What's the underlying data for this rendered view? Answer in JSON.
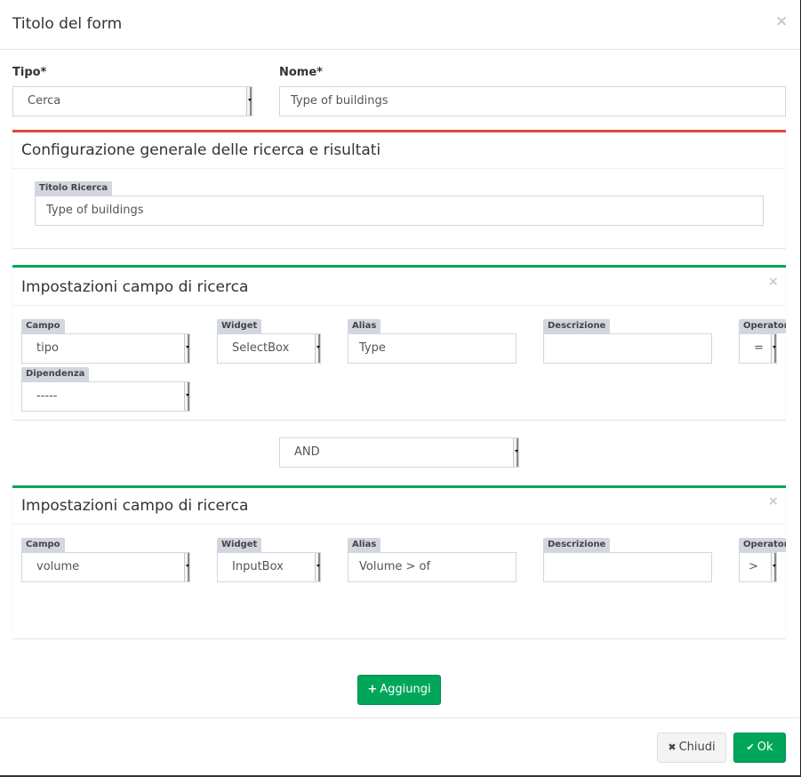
{
  "modal": {
    "title": "Titolo del form",
    "close_glyph": "×"
  },
  "form": {
    "tipo_label": "Tipo*",
    "tipo_value": "Cerca",
    "nome_label": "Nome*",
    "nome_value": "Type of buildings"
  },
  "general_box": {
    "title": "Configurazione generale delle ricerca e risultati",
    "titolo_ricerca_label": "Titolo Ricerca",
    "titolo_ricerca_value": "Type of buildings"
  },
  "search_fields": [
    {
      "title": "Impostazioni campo di ricerca",
      "campo_label": "Campo",
      "campo_value": "tipo",
      "widget_label": "Widget",
      "widget_value": "SelectBox",
      "alias_label": "Alias",
      "alias_value": "Type",
      "descrizione_label": "Descrizione",
      "descrizione_value": "",
      "operatore_label": "Operatore con",
      "operatore_value": "=",
      "dipendenza_label": "Dipendenza",
      "dipendenza_value": "-----"
    },
    {
      "title": "Impostazioni campo di ricerca",
      "campo_label": "Campo",
      "campo_value": "volume",
      "widget_label": "Widget",
      "widget_value": "InputBox",
      "alias_label": "Alias",
      "alias_value": "Volume > of",
      "descrizione_label": "Descrizione",
      "descrizione_value": "",
      "operatore_label": "Operatore con",
      "operatore_value": ">"
    }
  ],
  "connector": {
    "value": "AND"
  },
  "buttons": {
    "add_label": "Aggiungi",
    "add_glyph": "+",
    "close_label": "Chiudi",
    "close_glyph": "✖",
    "ok_label": "Ok",
    "ok_glyph": "✔"
  },
  "colors": {
    "primary_box": "#dd4b39",
    "field_box": "#00a65a",
    "success": "#00a65a"
  },
  "icons": {
    "modal_close": "close-icon",
    "add": "plus-icon",
    "dismiss": "times-icon",
    "confirm": "check-icon"
  }
}
